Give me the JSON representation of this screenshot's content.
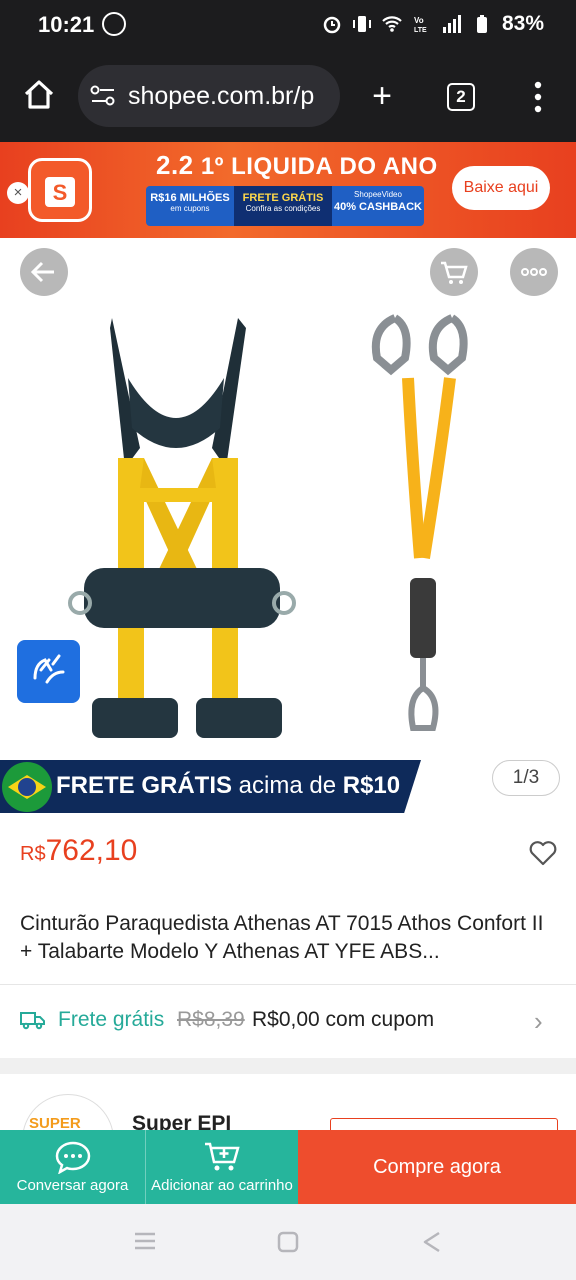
{
  "status_bar": {
    "time": "10:21",
    "battery": "83%"
  },
  "browser": {
    "url": "shopee.com.br/p",
    "tab_count": "2"
  },
  "promo_banner": {
    "headline_number": "2.2",
    "headline_text": "1º LIQUIDA DO ANO",
    "seg1_line1": "R$16 MILHÕES",
    "seg1_line2": "em cupons",
    "seg2_line1": "FRETE GRÁTIS",
    "seg2_line2": "Confira as condições",
    "seg3_line1": "ShopeeVideo",
    "seg3_line2": "40% CASHBACK",
    "cta": "Baixe aqui",
    "close": "×",
    "logo_letter": "S"
  },
  "gallery": {
    "pager": "1/3",
    "frete_bold": "FRETE GRÁTIS",
    "frete_rest": " acima de ",
    "frete_amount": "R$10"
  },
  "product": {
    "currency": "R$",
    "price": "762,10",
    "title": "Cinturão Paraquedista Athenas AT 7015 Athos Confort II + Talabarte Modelo Y Athenas AT YFE ABS..."
  },
  "shipping": {
    "label": "Frete grátis",
    "old_price": "R$8,39",
    "new_price": "R$0,00 com cupom"
  },
  "seller": {
    "avatar_text": "SUPER",
    "name": "Super EPI"
  },
  "actions": {
    "chat": "Conversar agora",
    "add_cart": "Adicionar ao carrinho",
    "buy": "Compre agora"
  },
  "colors": {
    "brand": "#ee4d2d",
    "teal": "#26b59c",
    "navy": "#0e2a5a"
  }
}
